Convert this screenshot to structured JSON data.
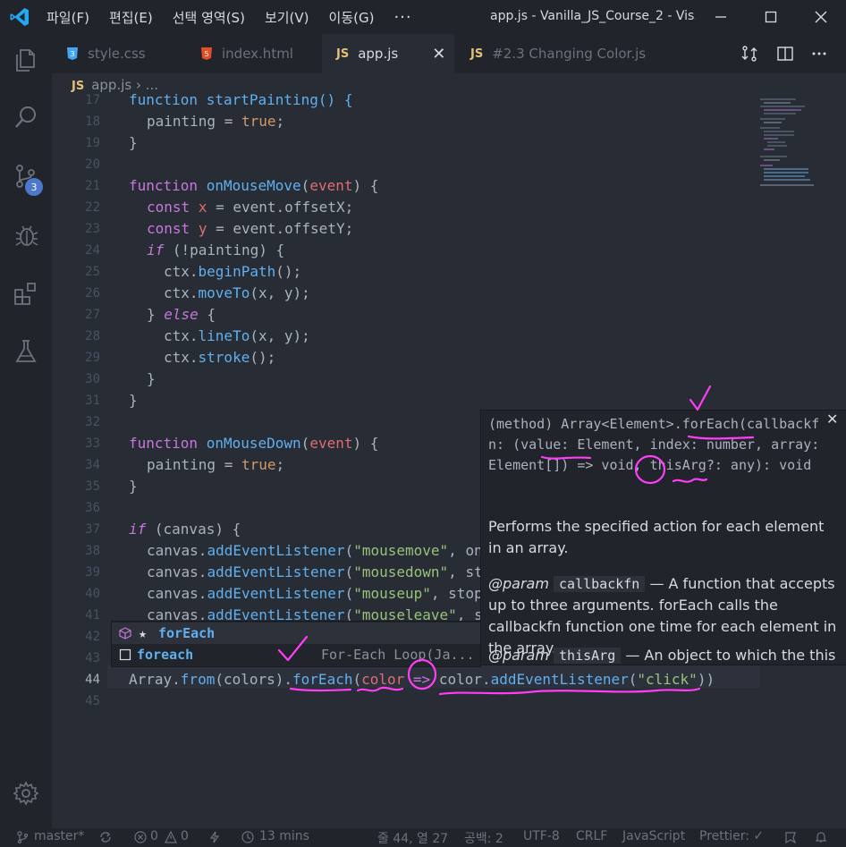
{
  "titlebar": {
    "menus": [
      "파일(F)",
      "편집(E)",
      "선택 영역(S)",
      "보기(V)",
      "이동(G)"
    ],
    "more": "···",
    "window_title": "app.js - Vanilla_JS_Course_2 - Vis...",
    "buttons": [
      "minimize",
      "maximize",
      "close"
    ]
  },
  "activity": {
    "icons": [
      "explorer-icon",
      "search-icon",
      "source-control-icon",
      "debug-icon",
      "extensions-icon",
      "testing-icon",
      "settings-gear-icon"
    ],
    "scm_badge": "3"
  },
  "tabs": [
    {
      "label": "style.css",
      "type": "css",
      "active": false
    },
    {
      "label": "index.html",
      "type": "html",
      "active": false
    },
    {
      "label": "app.js",
      "type": "js",
      "active": true,
      "js": "JS"
    },
    {
      "label": "#2.3 Changing Color.js",
      "type": "js",
      "active": false,
      "js": "JS"
    }
  ],
  "tab_close": "✕",
  "breadcrumb": {
    "js": "JS",
    "file": "app.js",
    "sep": "›",
    "rest": "..."
  },
  "code": {
    "lines": [
      17,
      18,
      19,
      20,
      21,
      22,
      23,
      24,
      25,
      26,
      27,
      28,
      29,
      30,
      31,
      32,
      33,
      34,
      35,
      36,
      37,
      38,
      39,
      40,
      41,
      42,
      43,
      44,
      45
    ],
    "l17": "function startPainting() {",
    "l18a": "painting",
    "l18b": " = ",
    "l18c": "true",
    "l18d": ";",
    "l19": "}",
    "l21_fn": "function",
    "l21_name": "onMouseMove",
    "l21_p": "event",
    "l22_k": "const",
    "l22_v": "x",
    "l22_r": " = event.offsetX;",
    "l23_k": "const",
    "l23_v": "y",
    "l23_r": " = event.offsetY;",
    "l24_k": "if",
    "l24_r": " (!painting) {",
    "l25_a": "ctx.",
    "l25_f": "beginPath",
    "l25_b": "();",
    "l26_a": "ctx.",
    "l26_f": "moveTo",
    "l26_b": "(x, y);",
    "l27_a": "} ",
    "l27_k": "else",
    "l27_b": " {",
    "l28_a": "ctx.",
    "l28_f": "lineTo",
    "l28_b": "(x, y);",
    "l29_a": "ctx.",
    "l29_f": "stroke",
    "l29_b": "();",
    "l30": "}",
    "l31": "}",
    "l33_fn": "function",
    "l33_name": "onMouseDown",
    "l33_p": "event",
    "l34a": "painting",
    "l34b": " = ",
    "l34c": "true",
    "l34d": ";",
    "l35": "}",
    "l37_k": "if",
    "l37_r": " (canvas) {",
    "l38_a": "canvas.",
    "l38_f": "addEventListener",
    "l38_s": "\"mousemove\"",
    "l38_r": ", on",
    "l39_a": "canvas.",
    "l39_f": "addEventListener",
    "l39_s": "\"mousedown\"",
    "l39_r": ", st",
    "l40_a": "canvas.",
    "l40_f": "addEventListener",
    "l40_s": "\"mouseup\"",
    "l40_r": ", stop",
    "l41_a": "canvas.",
    "l41_f": "addEventListener",
    "l41_s": "\"mouseleave\"",
    "l41_r": ", s",
    "l44_a": "Array.",
    "l44_b": "from",
    "l44_c": "(colors).",
    "l44_d": "forEach",
    "l44_e": "(",
    "l44_f": "color",
    "l44_g": " => ",
    "l44_h": "color.",
    "l44_i": "addEventListener",
    "l44_j": "(",
    "l44_k": "\"click\"",
    "l44_l": "))"
  },
  "hover": {
    "signature": "(method) Array<Element>.forEach(callbackfn: (value: Element, index: number, array: Element[]) => void, thisArg?: any): void",
    "close": "✕",
    "description": "Performs the specified action for each element in an array.",
    "param1_tag": "@param",
    "param1_name": "callbackfn",
    "param1_desc": "— A function that accepts up to three arguments. forEach calls the callbackfn function one time for each element in the array.",
    "param2_tag": "@param",
    "param2_name": "thisArg",
    "param2_desc": "— An object to which the this"
  },
  "suggest": {
    "item1": "forEach",
    "item1_star": "★",
    "item2": "foreach",
    "item2_detail": "For-Each Loop(Ja..."
  },
  "status": {
    "branch": "master*",
    "errors": "0",
    "warnings": "0",
    "time": "13 mins",
    "position": "줄 44, 열 27",
    "spaces": "공백: 2",
    "encoding": "UTF-8",
    "eol": "CRLF",
    "language": "JavaScript",
    "prettier": "Prettier: ✓"
  },
  "colors": {
    "accent_blue": "#4d78cc",
    "annotation_pink": "#ff3df5"
  }
}
